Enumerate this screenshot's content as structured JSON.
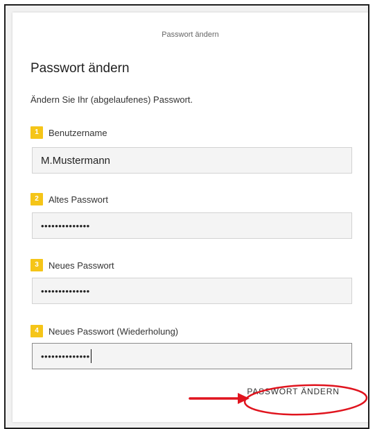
{
  "header": {
    "subtitle": "Passwort ändern"
  },
  "form": {
    "title": "Passwort ändern",
    "description": "Ändern Sie Ihr (abgelaufenes) Passwort.",
    "fields": [
      {
        "number": "1",
        "label": "Benutzername",
        "value": "M.Mustermann"
      },
      {
        "number": "2",
        "label": "Altes Passwort",
        "value": "••••••••••••••"
      },
      {
        "number": "3",
        "label": "Neues Passwort",
        "value": "••••••••••••••"
      },
      {
        "number": "4",
        "label": "Neues Passwort (Wiederholung)",
        "value": "••••••••••••••"
      }
    ],
    "submit_label": "PASSWORT ÄNDERN"
  },
  "colors": {
    "badge": "#f5c518",
    "annotation": "#e0141e"
  },
  "icons": {
    "annotation_arrow": "arrow-right-icon",
    "annotation_circle": "highlight-ellipse"
  }
}
